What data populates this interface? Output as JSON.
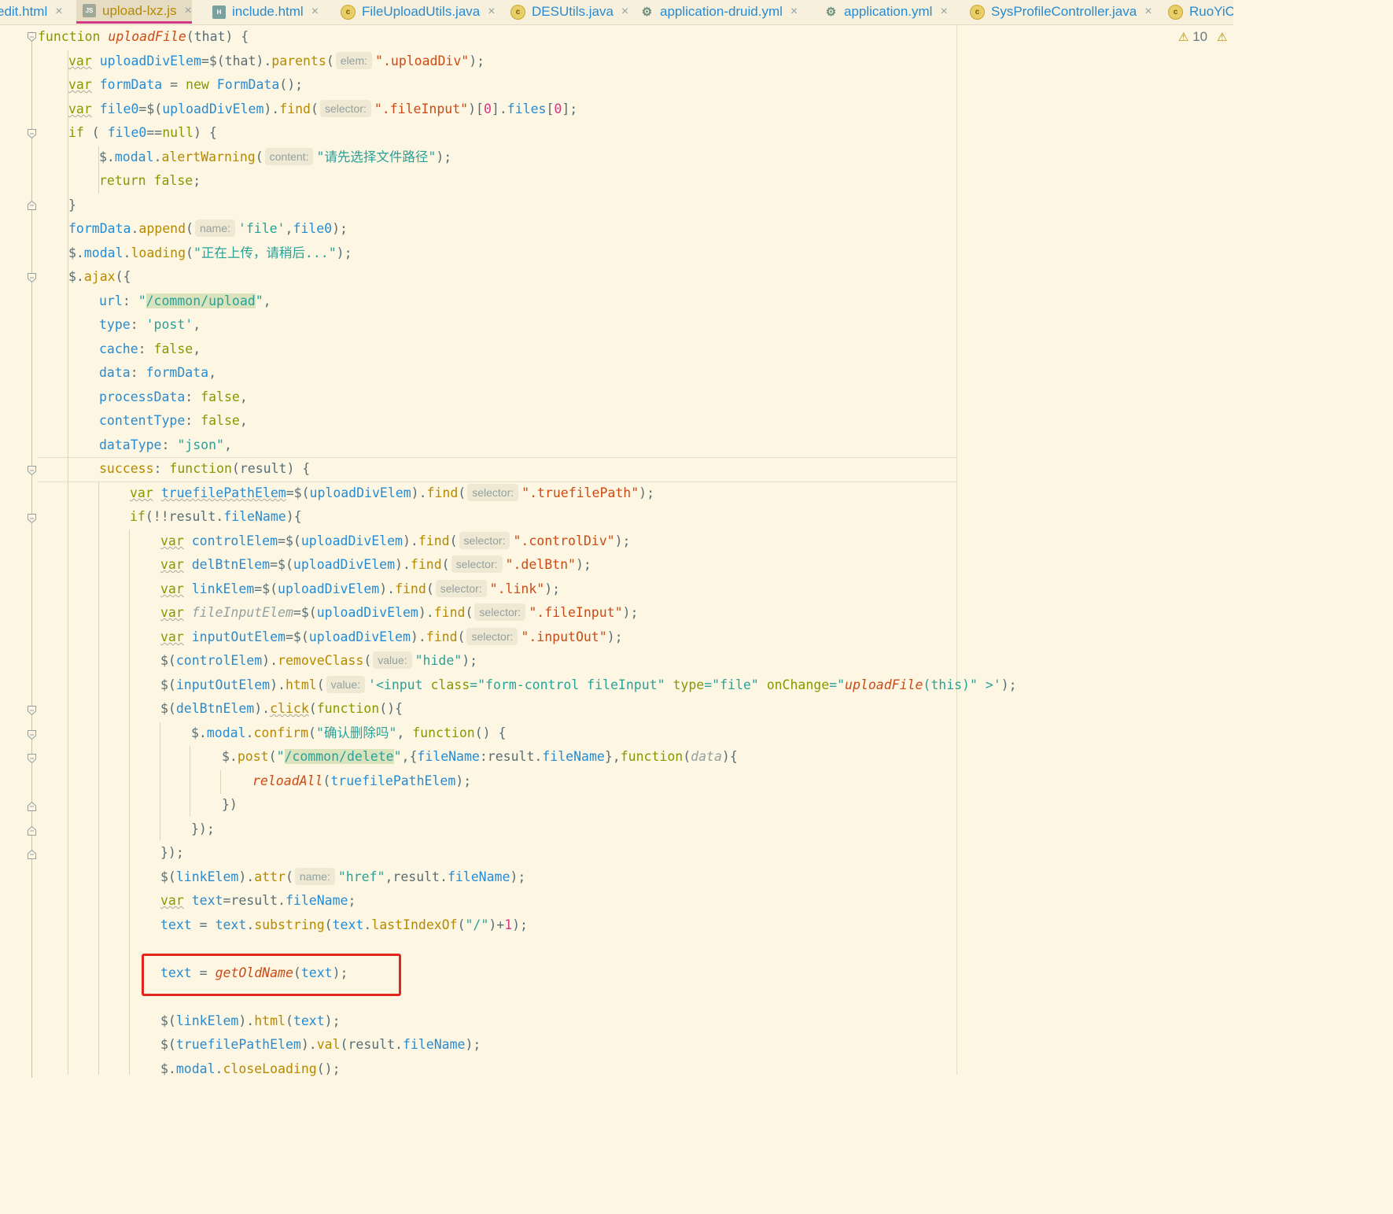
{
  "tabs": [
    {
      "label": "edit.html",
      "icon": "html"
    },
    {
      "label": "upload-lxz.js",
      "icon": "js",
      "active": true
    },
    {
      "label": "include.html",
      "icon": "html"
    },
    {
      "label": "FileUploadUtils.java",
      "icon": "java"
    },
    {
      "label": "DESUtils.java",
      "icon": "java"
    },
    {
      "label": "application-druid.yml",
      "icon": "yml"
    },
    {
      "label": "application.yml",
      "icon": "yml"
    },
    {
      "label": "SysProfileController.java",
      "icon": "java"
    },
    {
      "label": "RuoYiCo",
      "icon": "java"
    }
  ],
  "icons": {
    "close": "×",
    "java": "c",
    "js": "JS",
    "html": "H",
    "yml": "⚙",
    "warning": "⚠"
  },
  "inspections": {
    "warning_count": "10"
  },
  "hints": {
    "elem": "elem:",
    "selector": "selector:",
    "content": "content:",
    "name": "name:",
    "value": "value:"
  },
  "code": {
    "l1_fn": "function",
    "l1_name": "uploadFile",
    "l1_rest": "(that) {",
    "str_uploadDiv": "\".uploadDiv\"",
    "str_fileInput": "\".fileInput\"",
    "str_alert": "\"请先选择文件路径\"",
    "str_file": "'file'",
    "str_loading": "\"正在上传，请稍后...\"",
    "str_url": "/common/upload",
    "str_post": "'post'",
    "str_json": "\"json\"",
    "str_truefilePath": "\".truefilePath\"",
    "str_controlDiv": "\".controlDiv\"",
    "str_delBtn": "\".delBtn\"",
    "str_link": "\".link\"",
    "str_inputOut": "\".inputOut\"",
    "str_hide": "\"hide\"",
    "str_confirm": "\"确认删除吗\"",
    "str_delete": "/common/delete",
    "str_href": "\"href\"",
    "str_slash": "\"/\"",
    "getOldName": "getOldName"
  }
}
